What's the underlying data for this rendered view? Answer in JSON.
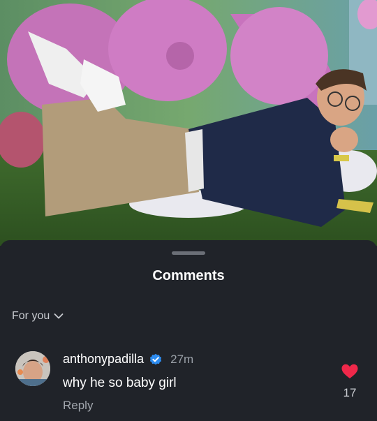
{
  "sheet": {
    "title": "Comments",
    "filter_label": "For you"
  },
  "comment": {
    "username": "anthonypadilla",
    "time": "27m",
    "text": "why he so baby girl",
    "reply_label": "Reply",
    "like_count": "17"
  },
  "colors": {
    "background": "#202329",
    "verified": "#2d8cf0",
    "like": "#f0284a"
  },
  "icons": {
    "verified": "verified-badge-icon",
    "chevron": "chevron-down-icon",
    "like": "heart-icon"
  }
}
